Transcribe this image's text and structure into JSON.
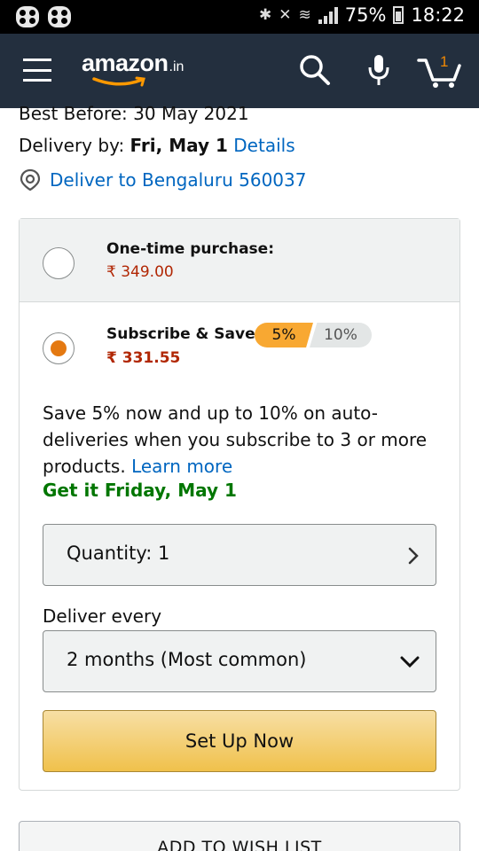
{
  "status_bar": {
    "battery": "75%",
    "time": "18:22"
  },
  "header": {
    "logo_word": "amazon",
    "logo_tld": ".in",
    "cart_count": "1",
    "icons": [
      "menu-icon",
      "search-icon",
      "microphone-icon",
      "cart-icon"
    ]
  },
  "product": {
    "best_before": "Best Before: 30 May 2021",
    "delivery_prefix": "Delivery by: ",
    "delivery_date": "Fri, May 1",
    "details_link": "Details",
    "deliver_to": "Deliver to Bengaluru 560037"
  },
  "one_time": {
    "title": "One-time purchase:",
    "price": "₹ 349.00",
    "selected": false
  },
  "subscribe": {
    "title": "Subscribe & Save:",
    "pill_active": "5%",
    "pill_inactive": "10%",
    "price": "₹ 331.55",
    "selected": true,
    "description": "Save 5% now and up to 10% on auto-deliveries when you subscribe to 3 or more products.",
    "learn_more": "Learn more",
    "get_it": "Get it Friday, May 1",
    "quantity_label": "Quantity: 1",
    "deliver_every_label": "Deliver every",
    "frequency_value": "2 months (Most common)",
    "cta": "Set Up Now"
  },
  "wishlist_button": "ADD TO WISH LIST",
  "colors": {
    "header_bg": "#232f3e",
    "price": "#b12704",
    "link": "#0066c0",
    "green": "#007600",
    "accent": "#e47911"
  }
}
